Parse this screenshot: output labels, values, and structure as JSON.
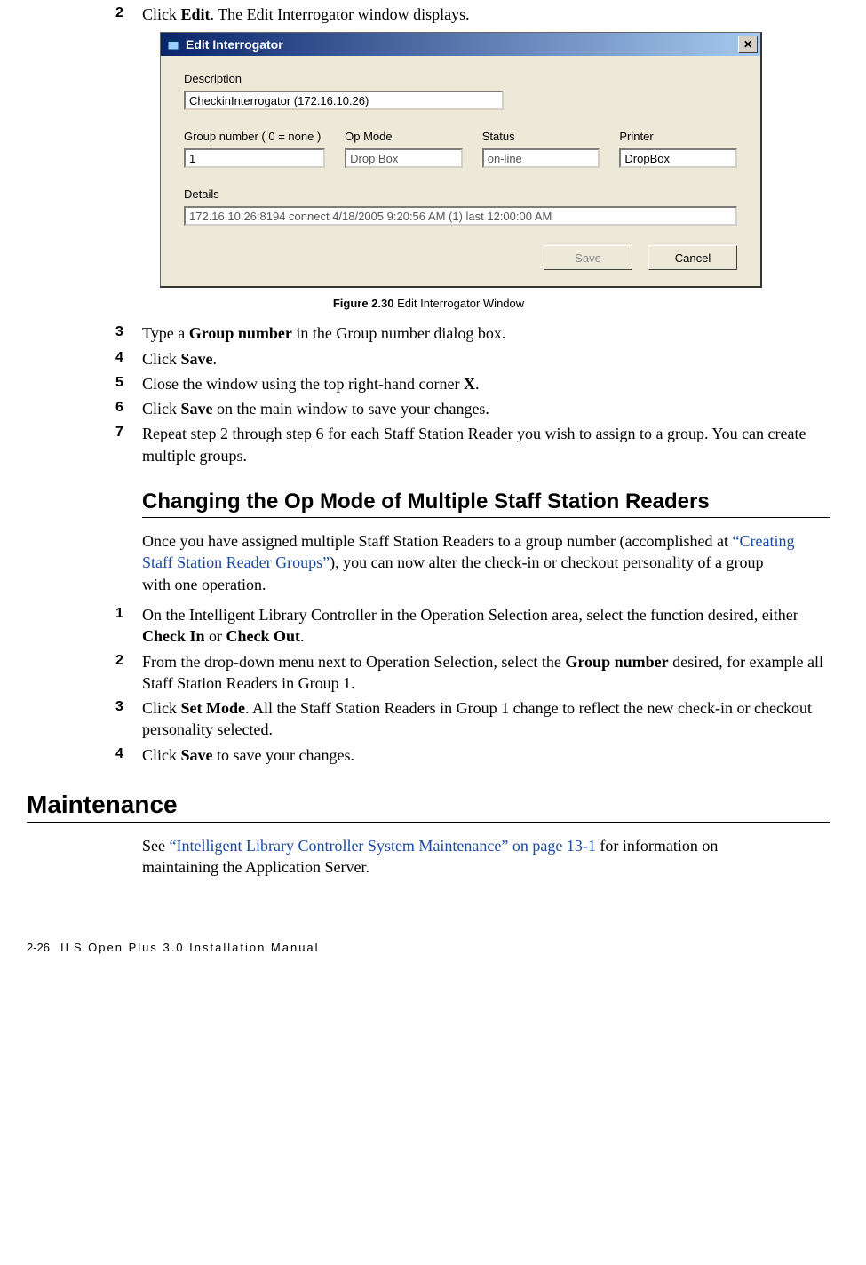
{
  "steps_a": {
    "2": {
      "pre": "Click ",
      "b": "Edit",
      "post": ". The Edit Interrogator window displays."
    }
  },
  "dialog": {
    "title": "Edit Interrogator",
    "close_glyph": "✕",
    "labels": {
      "description": "Description",
      "group": "Group number ( 0 = none )",
      "opmode": "Op Mode",
      "status": "Status",
      "printer": "Printer",
      "details": "Details"
    },
    "values": {
      "description": "CheckinInterrogator (172.16.10.26)",
      "group": "1",
      "opmode": "Drop Box",
      "status": "on-line",
      "printer": "DropBox",
      "details": "172.16.10.26:8194 connect 4/18/2005 9:20:56 AM (1) last 12:00:00 AM"
    },
    "buttons": {
      "save": "Save",
      "cancel": "Cancel"
    }
  },
  "figure": {
    "label": "Figure 2.30",
    "caption": " Edit Interrogator Window"
  },
  "steps_b": {
    "3": {
      "pre": "Type a ",
      "b": "Group number",
      "post": " in the Group number dialog box."
    },
    "4": {
      "pre": "Click ",
      "b": "Save",
      "post": "."
    },
    "5": {
      "pre": "Close the window using the top right-hand corner ",
      "b": "X",
      "post": "."
    },
    "6": {
      "pre": "Click ",
      "b": "Save",
      "post": " on the main window to save your changes."
    },
    "7": {
      "text": "Repeat step 2 through step 6 for each Staff Station Reader you wish to assign to a group. You can create multiple groups."
    }
  },
  "section1": {
    "heading": "Changing the Op Mode of Multiple Staff Station Readers",
    "intro_pre": "Once you have assigned multiple Staff Station Readers to a group number (accomplished at ",
    "intro_link": "“Creating Staff Station Reader Groups”",
    "intro_post": "), you can now alter the check-in or checkout personality of a group with one operation.",
    "steps": {
      "1": {
        "pre": "On the Intelligent Library Controller in the Operation Selection area, select the function desired, either ",
        "b1": "Check In",
        "mid": " or ",
        "b2": "Check Out",
        "post": "."
      },
      "2": {
        "pre": "From the drop-down menu next to Operation Selection, select the ",
        "b": "Group number",
        "post": " desired, for example all Staff Station Readers in Group 1."
      },
      "3": {
        "pre": "Click ",
        "b": "Set Mode",
        "post": ". All the Staff Station Readers in Group 1 change to reflect the new check-in or checkout personality selected."
      },
      "4": {
        "pre": "Click ",
        "b": "Save",
        "post": " to save your changes."
      }
    }
  },
  "section2": {
    "heading": "Maintenance",
    "para_pre": "See ",
    "para_link": "“Intelligent Library Controller System Maintenance” on page 13-1",
    "para_post": " for information on maintaining the Application Server."
  },
  "footer": {
    "page": "2-26",
    "title": "ILS Open Plus 3.0 Installation Manual"
  }
}
